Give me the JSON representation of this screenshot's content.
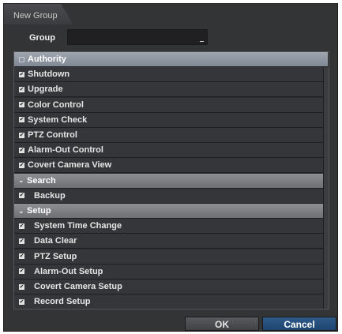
{
  "dialog": {
    "title": "New Group",
    "group_label": "Group",
    "group_value": ""
  },
  "rows": [
    {
      "label": "Authority",
      "kind": "header",
      "icon": "checkbox-icon"
    },
    {
      "label": "Shutdown",
      "kind": "item",
      "checked": true,
      "indent": false
    },
    {
      "label": "Upgrade",
      "kind": "item",
      "checked": true,
      "indent": false
    },
    {
      "label": "Color Control",
      "kind": "item",
      "checked": true,
      "indent": false
    },
    {
      "label": "System Check",
      "kind": "item",
      "checked": true,
      "indent": false
    },
    {
      "label": "PTZ Control",
      "kind": "item",
      "checked": true,
      "indent": false
    },
    {
      "label": "Alarm-Out Control",
      "kind": "item",
      "checked": true,
      "indent": false
    },
    {
      "label": "Covert Camera View",
      "kind": "item",
      "checked": true,
      "indent": false
    },
    {
      "label": "Search",
      "kind": "header",
      "icon": "chevron-down-icon"
    },
    {
      "label": "Backup",
      "kind": "item",
      "checked": true,
      "indent": true
    },
    {
      "label": "Setup",
      "kind": "header",
      "icon": "chevron-down-icon"
    },
    {
      "label": "System Time Change",
      "kind": "item",
      "checked": true,
      "indent": true
    },
    {
      "label": "Data Clear",
      "kind": "item",
      "checked": true,
      "indent": true
    },
    {
      "label": "PTZ Setup",
      "kind": "item",
      "checked": true,
      "indent": true
    },
    {
      "label": "Alarm-Out Setup",
      "kind": "item",
      "checked": true,
      "indent": true
    },
    {
      "label": "Covert Camera Setup",
      "kind": "item",
      "checked": true,
      "indent": true
    },
    {
      "label": "Record Setup",
      "kind": "item",
      "checked": true,
      "indent": true
    }
  ],
  "buttons": {
    "ok": "OK",
    "cancel": "Cancel"
  },
  "colors": {
    "panel": "#333436",
    "header_gray": "#7e7f83",
    "header_first": "#8f97a2",
    "cancel_blue": "#27507f"
  }
}
